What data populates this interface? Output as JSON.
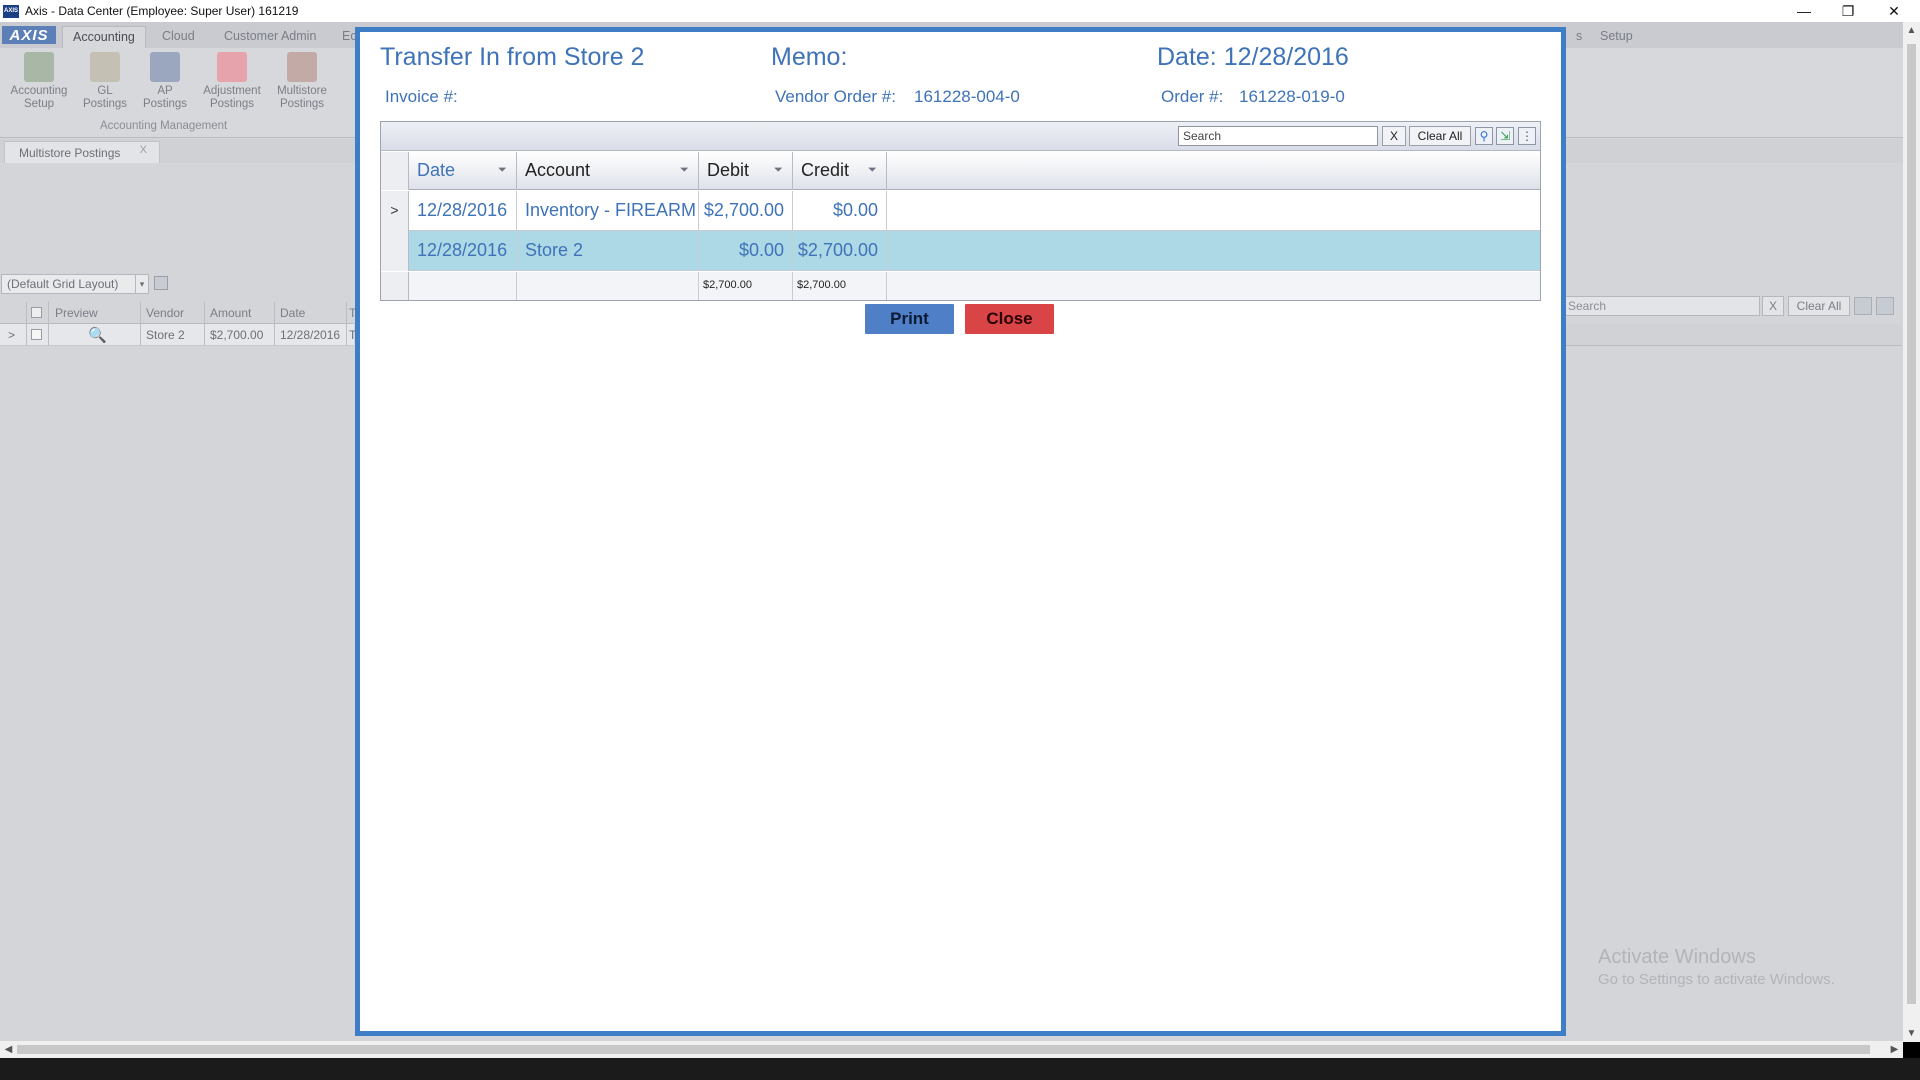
{
  "window": {
    "title": "Axis - Data Center  (Employee: Super User) 161219",
    "logo_text": "AXIS",
    "minimize": "—",
    "restore": "❐",
    "close": "✕"
  },
  "ribbon": {
    "logo": "AXIS",
    "tabs": [
      "Accounting",
      "Cloud",
      "Customer Admin",
      "Ec",
      "s",
      "Setup"
    ],
    "buttons": [
      {
        "line1": "Accounting",
        "line2": "Setup"
      },
      {
        "line1": "GL",
        "line2": "Postings"
      },
      {
        "line1": "AP",
        "line2": "Postings"
      },
      {
        "line1": "Adjustment",
        "line2": "Postings"
      },
      {
        "line1": "Multistore",
        "line2": "Postings"
      }
    ],
    "group_label": "Accounting Management"
  },
  "doc_tab": {
    "label": "Multistore Postings",
    "close": "X"
  },
  "background": {
    "layout_combo": "(Default Grid Layout)",
    "left_grid": {
      "headers": [
        "Preview",
        "Vendor",
        "Amount",
        "Date",
        "T"
      ],
      "row": {
        "expander": ">",
        "vendor": "Store 2",
        "amount": "$2,700.00",
        "date": "12/28/2016",
        "t": "T"
      }
    },
    "right_tools": {
      "search_placeholder": "Search",
      "x": "X",
      "clear_all": "Clear All"
    },
    "watermark": {
      "line1": "Activate Windows",
      "line2": "Go to Settings to activate Windows."
    }
  },
  "modal": {
    "title": "Transfer In from Store 2",
    "memo_label": "Memo:",
    "date_label": "Date: 12/28/2016",
    "invoice_label": "Invoice #:",
    "vendor_order_label": "Vendor Order #:",
    "vendor_order_value": "161228-004-0",
    "order_label": "Order #:",
    "order_value": "161228-019-0",
    "grid": {
      "search_placeholder": "Search",
      "x": "X",
      "clear_all": "Clear All",
      "columns": [
        "Date",
        "Account",
        "Debit",
        "Credit"
      ],
      "rows": [
        {
          "expander": ">",
          "date": "12/28/2016",
          "account": "Inventory - FIREARM",
          "debit": "$2,700.00",
          "credit": "$0.00"
        },
        {
          "expander": "",
          "date": "12/28/2016",
          "account": "Store 2",
          "debit": "$0.00",
          "credit": "$2,700.00"
        }
      ],
      "totals": {
        "debit": "$2,700.00",
        "credit": "$2,700.00"
      }
    },
    "print_label": "Print",
    "close_label": "Close"
  },
  "scrollbars": {
    "up": "▲",
    "down": "▼",
    "left": "◀",
    "right": "▶"
  }
}
